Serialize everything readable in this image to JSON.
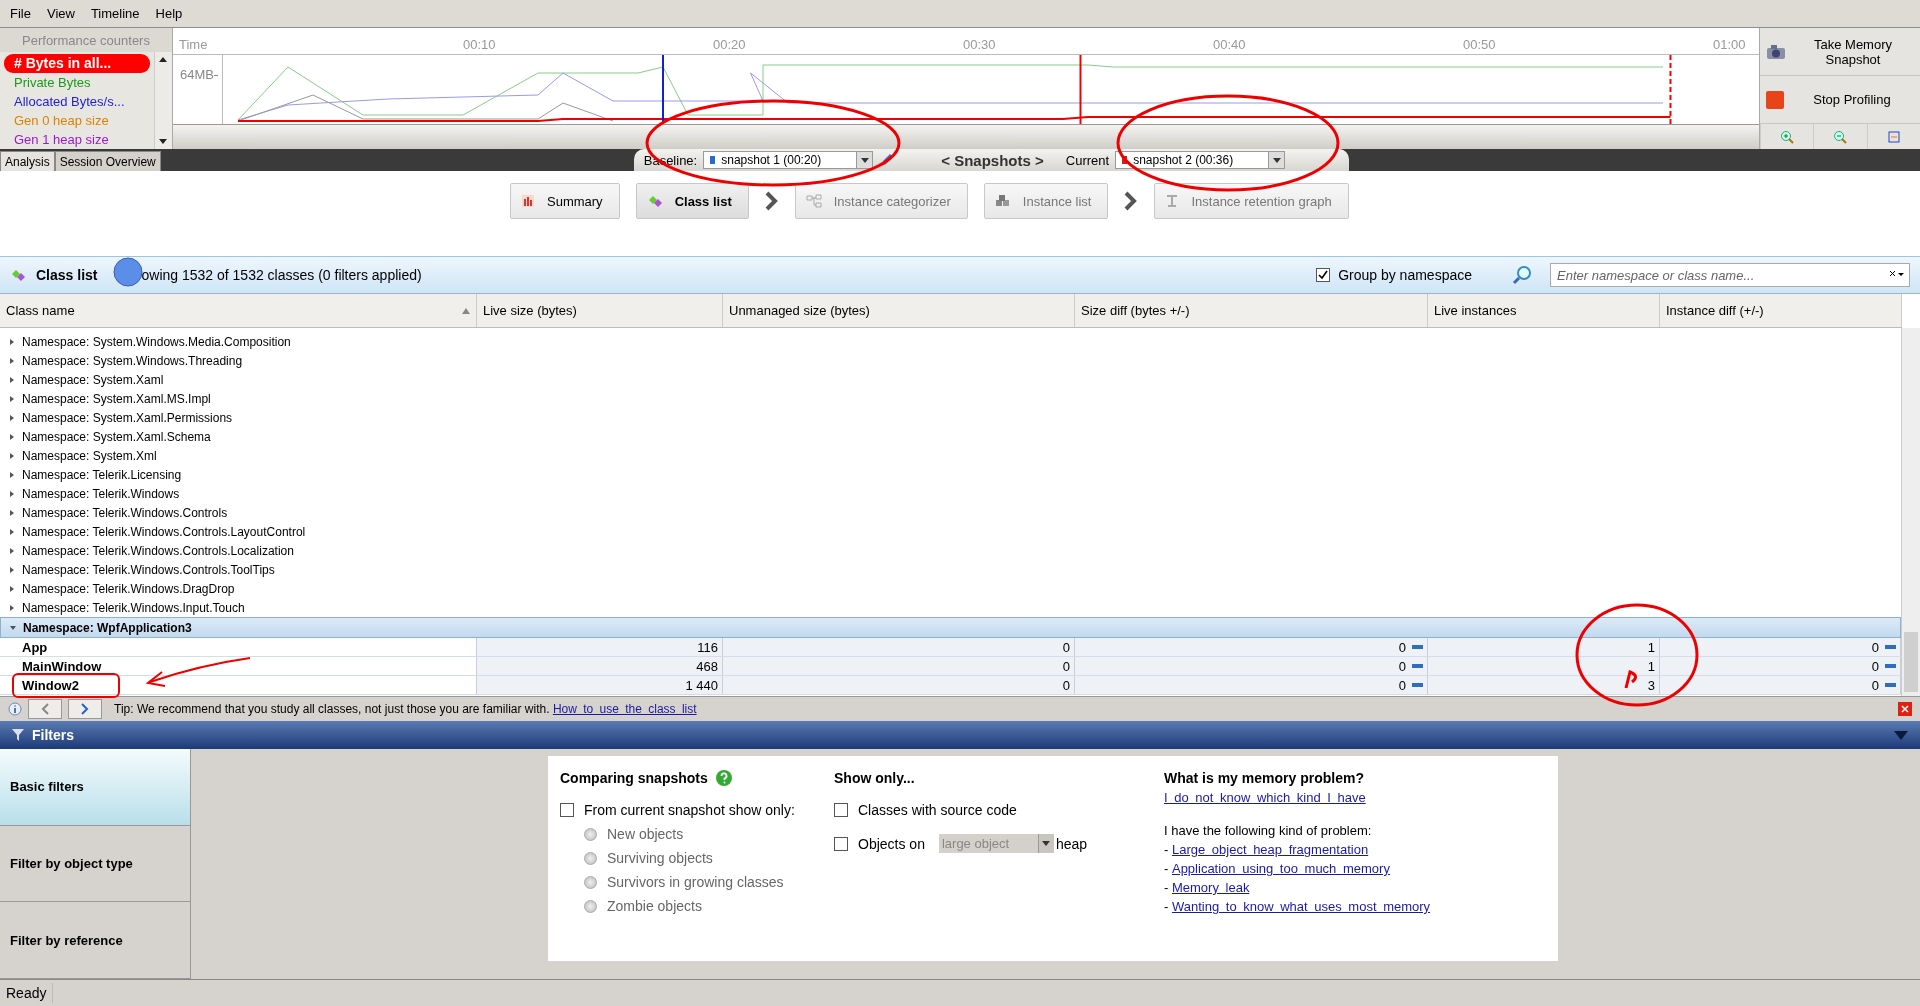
{
  "menu": [
    "File",
    "View",
    "Timeline",
    "Help"
  ],
  "counters": {
    "title": "Performance counters",
    "items": [
      {
        "label": "# Bytes in all...",
        "color": "#ff0000",
        "selected": true
      },
      {
        "label": "Private Bytes",
        "color": "#1a9a1a",
        "selected": false
      },
      {
        "label": "Allocated  Bytes/s...",
        "color": "#1f1fd0",
        "selected": false
      },
      {
        "label": "Gen 0 heap size",
        "color": "#d98300",
        "selected": false
      },
      {
        "label": "Gen 1 heap size",
        "color": "#9a1ad0",
        "selected": false
      }
    ]
  },
  "timeline": {
    "axis_label": "Time",
    "ticks": [
      "00:10",
      "00:20",
      "00:30",
      "00:40",
      "00:50",
      "01:00"
    ],
    "y_label": "64MB"
  },
  "actions": [
    {
      "label": "Take Memory Snapshot",
      "kind": "camera"
    },
    {
      "label": "Stop Profiling",
      "kind": "stop"
    }
  ],
  "view_tabs": [
    {
      "label": "Analysis",
      "selected": true
    },
    {
      "label": "Session Overview",
      "selected": false
    }
  ],
  "snapshots": {
    "baseline_label": "Baseline:",
    "baseline": "snapshot 1 (00:20)",
    "title": "< Snapshots >",
    "current_label": "Current",
    "current": "snapshot 2 (00:36)"
  },
  "steps": [
    {
      "kind": "step",
      "label": "Summary",
      "selected": false,
      "disabled": false
    },
    {
      "kind": "step",
      "label": "Class list",
      "selected": true,
      "disabled": false
    },
    {
      "kind": "arrow"
    },
    {
      "kind": "step",
      "label": "Instance categorizer",
      "selected": false,
      "disabled": true
    },
    {
      "kind": "step",
      "label": "Instance list",
      "selected": false,
      "disabled": true
    },
    {
      "kind": "arrow"
    },
    {
      "kind": "step",
      "label": "Instance retention graph",
      "selected": false,
      "disabled": true
    }
  ],
  "class_list": {
    "title": "Class list",
    "status": "owing 1532 of 1532 classes (0 filters applied)",
    "group_by": {
      "label": "Group by namespace",
      "checked": true
    },
    "search": {
      "placeholder": "Enter namespace or class name..."
    }
  },
  "table": {
    "columns": [
      {
        "label": "Class name",
        "sorted": true
      },
      {
        "label": "Live size (bytes)",
        "sorted": false
      },
      {
        "label": "Unmanaged size (bytes)",
        "sorted": false
      },
      {
        "label": "Size diff (bytes +/-)",
        "sorted": false
      },
      {
        "label": "Live instances",
        "sorted": false
      },
      {
        "label": "Instance diff (+/-)",
        "sorted": false
      }
    ],
    "rows": [
      {
        "name": "Namespace: System.Windows.Media.Composition",
        "expanded": false
      },
      {
        "name": "Namespace: System.Windows.Threading",
        "expanded": false
      },
      {
        "name": "Namespace: System.Xaml",
        "expanded": false
      },
      {
        "name": "Namespace: System.Xaml.MS.Impl",
        "expanded": false
      },
      {
        "name": "Namespace: System.Xaml.Permissions",
        "expanded": false
      },
      {
        "name": "Namespace: System.Xaml.Schema",
        "expanded": false
      },
      {
        "name": "Namespace: System.Xml",
        "expanded": false
      },
      {
        "name": "Namespace: Telerik.Licensing",
        "expanded": false
      },
      {
        "name": "Namespace: Telerik.Windows",
        "expanded": false
      },
      {
        "name": "Namespace: Telerik.Windows.Controls",
        "expanded": false
      },
      {
        "name": "Namespace: Telerik.Windows.Controls.LayoutControl",
        "expanded": false
      },
      {
        "name": "Namespace: Telerik.Windows.Controls.Localization",
        "expanded": false
      },
      {
        "name": "Namespace: Telerik.Windows.Controls.ToolTips",
        "expanded": false
      },
      {
        "name": "Namespace: Telerik.Windows.DragDrop",
        "expanded": false
      },
      {
        "name": "Namespace: Telerik.Windows.Input.Touch",
        "expanded": false
      },
      {
        "name": "Namespace: WpfApplication3",
        "expanded": true,
        "children": [
          {
            "name": "App",
            "cells": [
              {
                "value": "116",
                "unchanged": false
              },
              {
                "value": "0",
                "unchanged": false
              },
              {
                "value": "0",
                "unchanged": true
              },
              {
                "value": "1",
                "unchanged": false
              },
              {
                "value": "0",
                "unchanged": true
              }
            ]
          },
          {
            "name": "MainWindow",
            "cells": [
              {
                "value": "468",
                "unchanged": false
              },
              {
                "value": "0",
                "unchanged": false
              },
              {
                "value": "0",
                "unchanged": true
              },
              {
                "value": "1",
                "unchanged": false
              },
              {
                "value": "0",
                "unchanged": true
              }
            ]
          },
          {
            "name": "Window2",
            "cells": [
              {
                "value": "1 440",
                "unchanged": false
              },
              {
                "value": "0",
                "unchanged": false
              },
              {
                "value": "0",
                "unchanged": true
              },
              {
                "value": "3",
                "unchanged": false
              },
              {
                "value": "0",
                "unchanged": true
              }
            ]
          }
        ]
      }
    ]
  },
  "tip": {
    "text": "Tip: We recommend that you study all classes, not just those you are familiar with.",
    "link": "How to use the class list"
  },
  "filters": {
    "title": "Filters",
    "nav": [
      {
        "label": "Basic filters",
        "selected": true
      },
      {
        "label": "Filter by object type",
        "selected": false
      },
      {
        "label": "Filter by reference",
        "selected": false
      }
    ],
    "comparing": {
      "title": "Comparing snapshots",
      "checkbox": {
        "label": "From current snapshot show only:",
        "checked": false
      },
      "options": [
        {
          "label": "New objects",
          "selected": false
        },
        {
          "label": "Surviving objects",
          "selected": false
        },
        {
          "label": "Survivors in growing classes",
          "selected": false
        },
        {
          "label": "Zombie objects",
          "selected": false
        }
      ]
    },
    "show_only": {
      "title": "Show only...",
      "items": [
        {
          "kind": "checkbox",
          "label": "Classes with source code",
          "checked": false
        },
        {
          "kind": "heap",
          "label": "Objects on",
          "value": "large object",
          "disabled": true,
          "suffix": "heap",
          "checked": false
        }
      ]
    },
    "problem": {
      "title": "What is my memory problem?",
      "link": "I do not know which kind I have",
      "intro": "I have the following kind of problem:",
      "links": [
        {
          "bullet": "-",
          "label": "Large object heap fragmentation"
        },
        {
          "bullet": "-",
          "label": "Application using too much memory"
        },
        {
          "bullet": "-",
          "label": "Memory leak"
        },
        {
          "bullet": "-",
          "label": "Wanting to know what uses most memory"
        }
      ]
    }
  },
  "status_bar": "Ready"
}
